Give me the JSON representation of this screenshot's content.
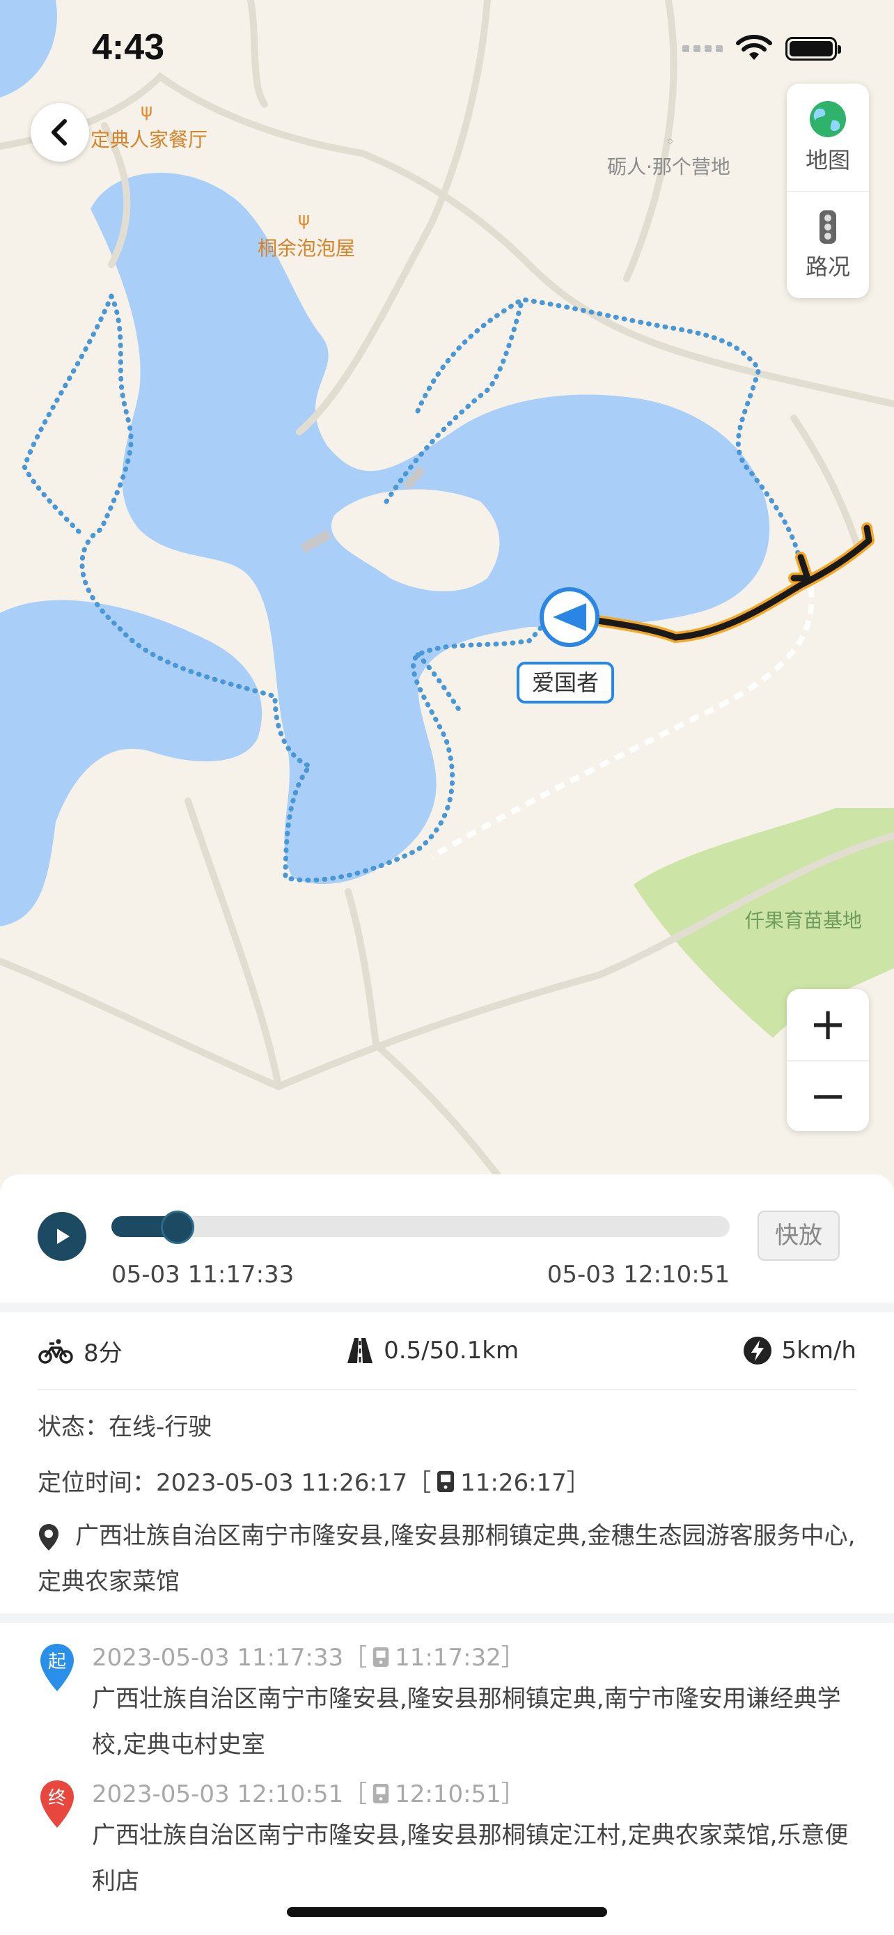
{
  "status_bar": {
    "time": "4:43"
  },
  "map": {
    "pois": {
      "restaurant": "定典人家餐厅",
      "guesthouse": "桐余泡泡屋",
      "camp": "砺人·那个营地",
      "nursery": "仟果育苗基地"
    },
    "controls": {
      "layers_label": "地图",
      "traffic_label": "路况",
      "zoom_in": "+",
      "zoom_out": "−"
    },
    "vehicle_label": "爱国者",
    "colors": {
      "water": "#a9cff8",
      "land": "#f6f2e9",
      "green": "#cce5a6",
      "track_dots": "#4a97d6",
      "played_track": "#1a1a1a",
      "played_track_border": "#f5a623"
    }
  },
  "playback": {
    "progress": 0.08,
    "start_time": "05-03 11:17:33",
    "end_time": "05-03 12:10:51",
    "fast_label": "快放"
  },
  "info": {
    "duration": "8分",
    "distance": "0.5/50.1km",
    "speed": "5km/h",
    "status": "状态：在线-行驶",
    "located_time": "定位时间：2023-05-03 11:26:17［",
    "located_time_device": "11:26:17］",
    "address": "广西壮族自治区南宁市隆安县,隆安县那桐镇定典,金穗生态园游客服务中心,定典农家菜馆"
  },
  "route": {
    "start_mark": "起",
    "start_time": "2023-05-03 11:17:33［",
    "start_time_device": "11:17:32］",
    "start_address": "广西壮族自治区南宁市隆安县,隆安县那桐镇定典,南宁市隆安用谦经典学校,定典屯村史室",
    "end_mark": "终",
    "end_time": "2023-05-03 12:10:51［",
    "end_time_device": "12:10:51］",
    "end_address": "广西壮族自治区南宁市隆安县,隆安县那桐镇定江村,定典农家菜馆,乐意便利店",
    "colors": {
      "start": "#2a8fe8",
      "end": "#e8473d"
    }
  }
}
